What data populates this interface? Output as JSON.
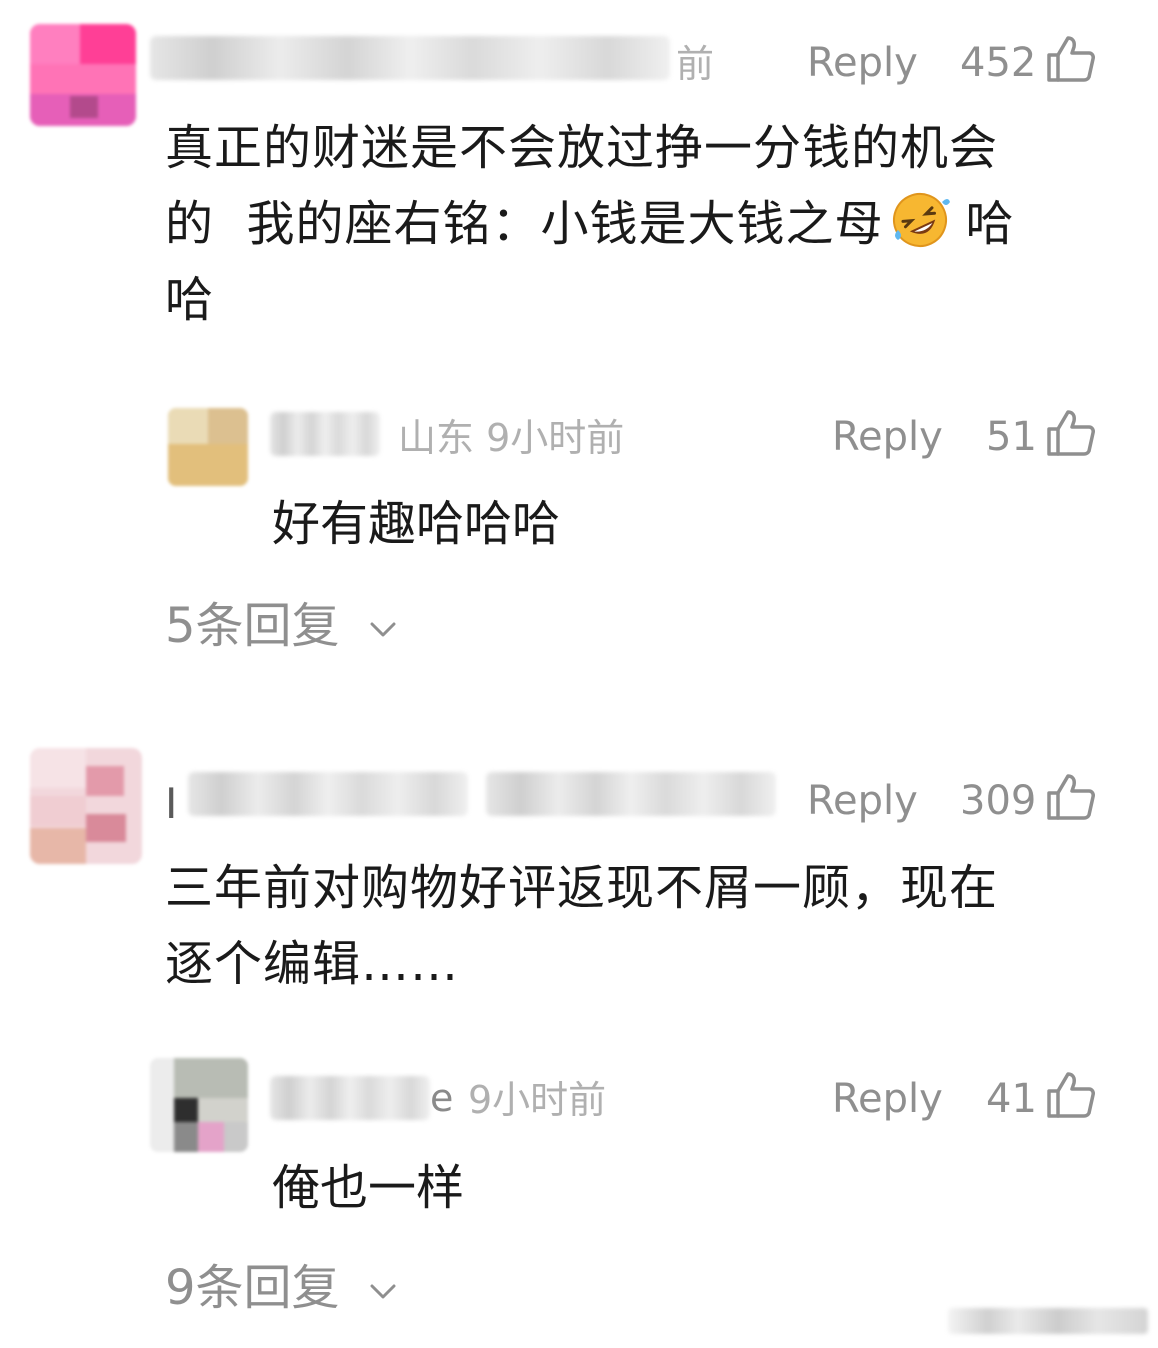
{
  "comments": [
    {
      "meta": "前",
      "reply_label": "Reply",
      "likes": "452",
      "text_line1": "真正的财迷是不会放过挣一分钱的机会",
      "text_line2_a": "的  我的座右铭：小钱是大钱之母",
      "text_line2_b": "哈",
      "text_line3": "哈",
      "emoji": "rolling-on-floor-laughing-emoji",
      "sub_reply": {
        "meta": "山东 9小时前",
        "reply_label": "Reply",
        "likes": "51",
        "text": "好有趣哈哈哈"
      },
      "more_replies": "5条回复"
    },
    {
      "name_fragment": "I",
      "reply_label": "Reply",
      "likes": "309",
      "text_line1": "三年前对购物好评返现不屑一顾，现在",
      "text_line2": "逐个编辑……",
      "sub_reply": {
        "name_fragment": "e",
        "meta": "9小时前",
        "reply_label": "Reply",
        "likes": "41",
        "text": "俺也一样"
      },
      "more_replies": "9条回复"
    }
  ],
  "colors": {
    "text": "#1a1a1a",
    "meta": "#b0b0b0",
    "action": "#8f8f8f",
    "background": "#ffffff"
  }
}
